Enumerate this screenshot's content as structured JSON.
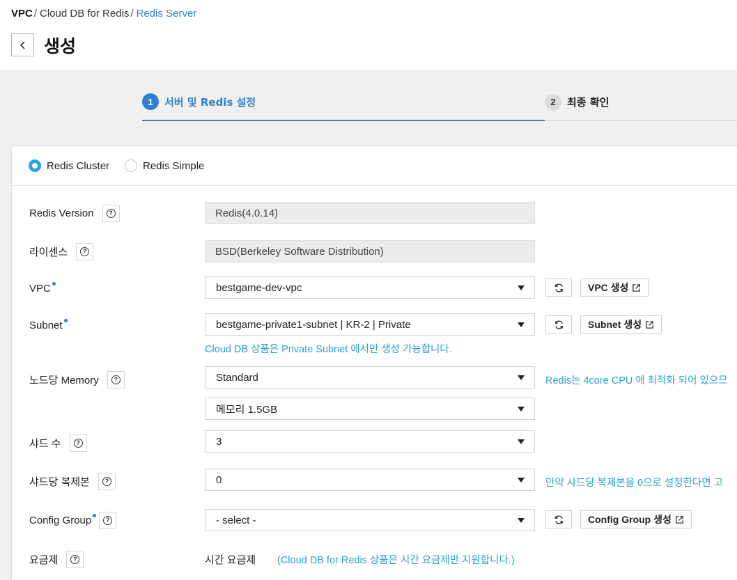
{
  "breadcrumb": {
    "item1": "VPC",
    "item2": "Cloud DB for Redis",
    "item3": "Redis Server",
    "sep": "/"
  },
  "page": {
    "title": "생성"
  },
  "steps": [
    {
      "num": "1",
      "label": "서버 및 Redis 설정"
    },
    {
      "num": "2",
      "label": "최종 확인"
    }
  ],
  "server_type": {
    "option1": "Redis Cluster",
    "option2": "Redis Simple",
    "selected": "Redis Cluster"
  },
  "form": {
    "version": {
      "label": "Redis Version",
      "value": "Redis(4.0.14)"
    },
    "license": {
      "label": "라이센스",
      "value": "BSD(Berkeley Software Distribution)"
    },
    "vpc": {
      "label": "VPC",
      "value": "bestgame-dev-vpc",
      "create": "VPC 생성"
    },
    "subnet": {
      "label": "Subnet",
      "value": "bestgame-private1-subnet | KR-2 | Private",
      "create": "Subnet 생성",
      "note": "Cloud DB 상품은 Private Subnet 에서만 생성 가능합니다."
    },
    "memory": {
      "label": "노드당 Memory",
      "type": "Standard",
      "size": "메모리 1.5GB",
      "note": "Redis는 4core CPU 에 최적화 되어 있으므"
    },
    "shards": {
      "label": "샤드 수",
      "value": "3"
    },
    "replicas": {
      "label": "샤드당 복제본",
      "value": "0",
      "note": "만약 샤드당 복제본을 0으로 설정한다면 고"
    },
    "config_group": {
      "label": "Config Group",
      "value": "- select -",
      "create": "Config Group 생성"
    },
    "billing": {
      "label": "요금제",
      "value": "시간 요금제",
      "note": "(Cloud DB for Redis 상품은 시간 요금제만 지원합니다.)"
    }
  }
}
